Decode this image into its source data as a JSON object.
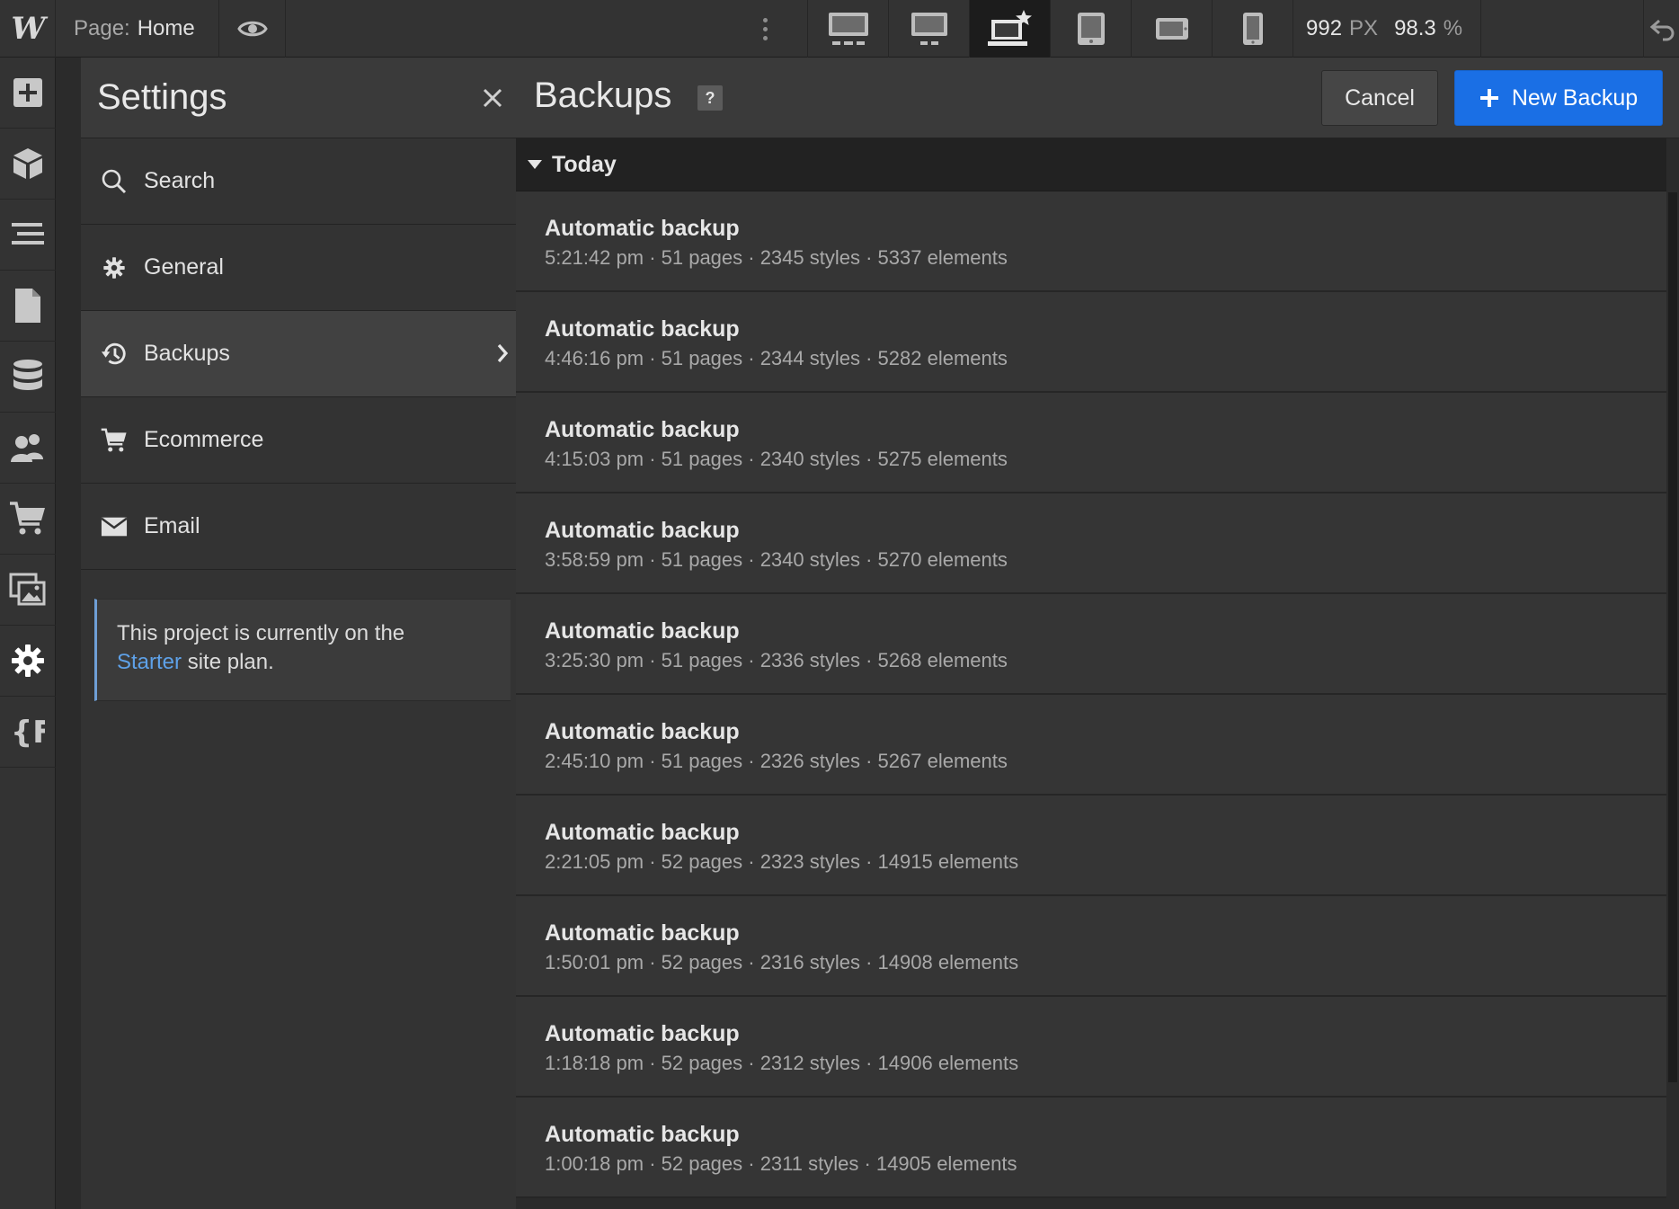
{
  "topbar": {
    "logo": "W",
    "page_label": "Page:",
    "page_name": "Home",
    "width_value": "992",
    "width_unit": "PX",
    "zoom_value": "98.3",
    "zoom_unit": "%"
  },
  "settings": {
    "title": "Settings",
    "menu": [
      {
        "label": "Search",
        "icon": "search-icon"
      },
      {
        "label": "General",
        "icon": "gear-icon"
      },
      {
        "label": "Backups",
        "icon": "history-icon"
      },
      {
        "label": "Ecommerce",
        "icon": "cart-icon"
      },
      {
        "label": "Email",
        "icon": "envelope-icon"
      }
    ],
    "note_prefix": "This project is currently on the",
    "note_link": "Starter",
    "note_suffix": "site plan."
  },
  "backups": {
    "title": "Backups",
    "help": "?",
    "cancel_label": "Cancel",
    "new_backup_label": "New Backup",
    "group_label": "Today",
    "items": [
      {
        "name": "Automatic backup",
        "meta": "5:21:42 pm · 51 pages · 2345 styles · 5337 elements"
      },
      {
        "name": "Automatic backup",
        "meta": "4:46:16 pm · 51 pages · 2344 styles · 5282 elements"
      },
      {
        "name": "Automatic backup",
        "meta": "4:15:03 pm · 51 pages · 2340 styles · 5275 elements"
      },
      {
        "name": "Automatic backup",
        "meta": "3:58:59 pm · 51 pages · 2340 styles · 5270 elements"
      },
      {
        "name": "Automatic backup",
        "meta": "3:25:30 pm · 51 pages · 2336 styles · 5268 elements"
      },
      {
        "name": "Automatic backup",
        "meta": "2:45:10 pm · 51 pages · 2326 styles · 5267 elements"
      },
      {
        "name": "Automatic backup",
        "meta": "2:21:05 pm · 52 pages · 2323 styles · 14915 elements"
      },
      {
        "name": "Automatic backup",
        "meta": "1:50:01 pm · 52 pages · 2316 styles · 14908 elements"
      },
      {
        "name": "Automatic backup",
        "meta": "1:18:18 pm · 52 pages · 2312 styles · 14906 elements"
      },
      {
        "name": "Automatic backup",
        "meta": "1:00:18 pm · 52 pages · 2311 styles · 14905 elements"
      }
    ]
  },
  "colors": {
    "accent": "#1a6fe5",
    "link": "#5ea1e8",
    "note_border": "#6f9fd6"
  }
}
